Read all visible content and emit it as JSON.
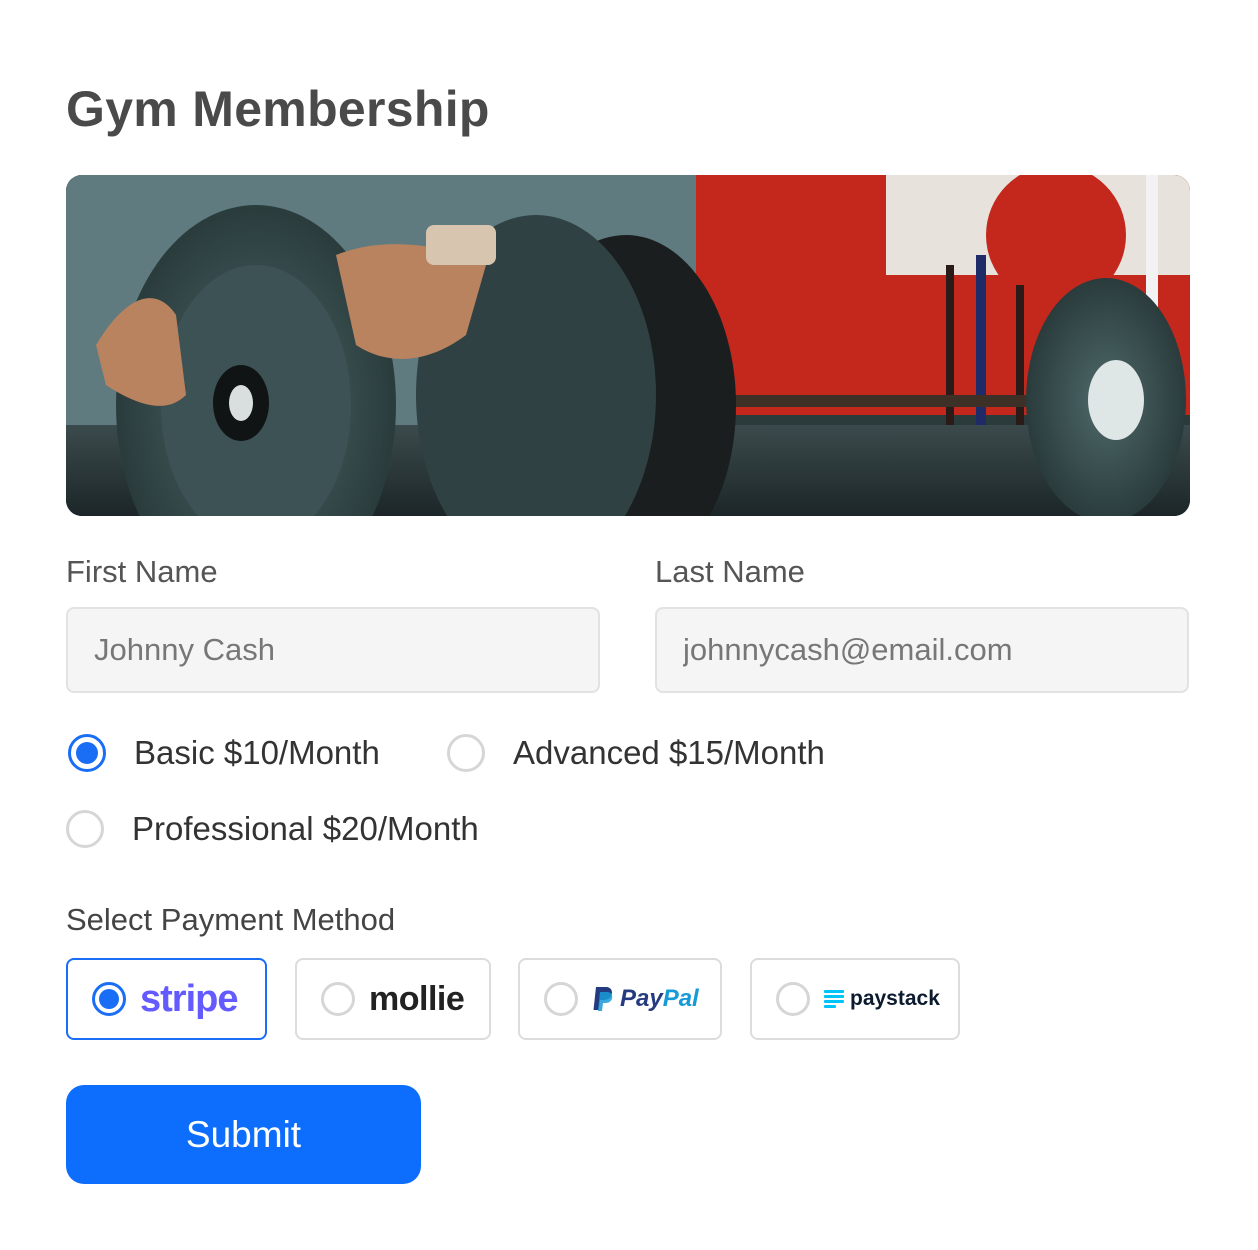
{
  "page": {
    "title": "Gym Membership"
  },
  "form": {
    "first_name": {
      "label": "First Name",
      "value": "Johnny Cash"
    },
    "last_name": {
      "label": "Last Name",
      "value": "johnnycash@email.com"
    },
    "plans": [
      {
        "label": "Basic $10/Month",
        "selected": true
      },
      {
        "label": "Advanced $15/Month",
        "selected": false
      },
      {
        "label": "Professional $20/Month",
        "selected": false
      }
    ],
    "payment": {
      "label": "Select Payment Method",
      "methods": [
        {
          "name": "stripe",
          "selected": true
        },
        {
          "name": "mollie",
          "selected": false
        },
        {
          "name_pay": "Pay",
          "name_pal": "Pal",
          "selected": false
        },
        {
          "name": "paystack",
          "selected": false
        }
      ]
    },
    "submit_label": "Submit"
  },
  "colors": {
    "accent": "#0d6efd",
    "radio_checked": "#1a6ef5"
  }
}
